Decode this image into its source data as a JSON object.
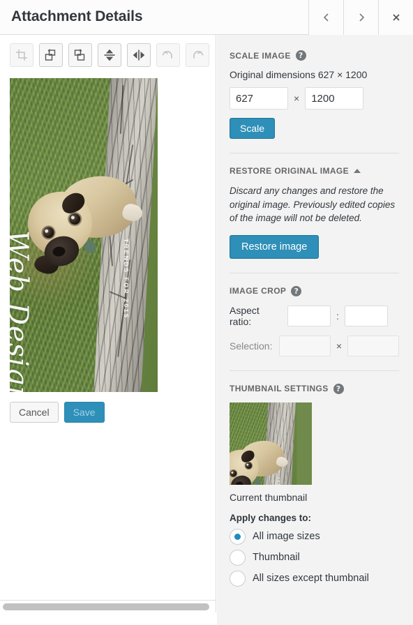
{
  "titlebar": {
    "title": "Attachment Details",
    "prev_label": "‹",
    "next_label": "›",
    "close_label": "×"
  },
  "toolbar": {
    "tools": [
      {
        "name": "crop-icon",
        "label": "Crop",
        "enabled": false
      },
      {
        "name": "rotate-left-icon",
        "label": "Rotate left",
        "enabled": true
      },
      {
        "name": "rotate-right-icon",
        "label": "Rotate right",
        "enabled": true
      },
      {
        "name": "flip-vertical-icon",
        "label": "Flip vertical",
        "enabled": true
      },
      {
        "name": "flip-horizontal-icon",
        "label": "Flip horizontal",
        "enabled": true
      },
      {
        "name": "undo-icon",
        "label": "Undo",
        "enabled": false
      },
      {
        "name": "redo-icon",
        "label": "Redo",
        "enabled": false
      }
    ]
  },
  "editor_image": {
    "overlay_title": "Web Design",
    "overlay_subtitle": "TRENDS FOR 2015",
    "alt": "Pug dog sitting on grass next to a tree trunk"
  },
  "actions": {
    "cancel_label": "Cancel",
    "save_label": "Save",
    "save_enabled": false
  },
  "scale_image": {
    "heading": "SCALE IMAGE",
    "help": "?",
    "original_dimensions": "Original dimensions 627 × 1200",
    "width_value": "627",
    "height_value": "1200",
    "separator": "×",
    "scale_button": "Scale"
  },
  "restore_original": {
    "heading": "RESTORE ORIGINAL IMAGE",
    "description": "Discard any changes and restore the original image. Previously edited copies of the image will not be deleted.",
    "restore_button": "Restore image"
  },
  "image_crop": {
    "heading": "IMAGE CROP",
    "help": "?",
    "aspect_ratio_label": "Aspect ratio:",
    "aspect_ratio_w": "",
    "aspect_ratio_h": "",
    "aspect_separator": ":",
    "selection_label": "Selection:",
    "selection_w": "",
    "selection_h": "",
    "selection_separator": "×"
  },
  "thumbnail_settings": {
    "heading": "THUMBNAIL SETTINGS",
    "help": "?",
    "current_thumbnail_caption": "Current thumbnail",
    "apply_label": "Apply changes to:",
    "options": [
      {
        "label": "All image sizes",
        "checked": true
      },
      {
        "label": "Thumbnail",
        "checked": false
      },
      {
        "label": "All sizes except thumbnail",
        "checked": false
      }
    ]
  },
  "colors": {
    "accent_blue": "#2e8fb8",
    "radio_blue": "#1e8cbe",
    "panel_bg": "#f3f3f3",
    "text": "#32373c"
  }
}
